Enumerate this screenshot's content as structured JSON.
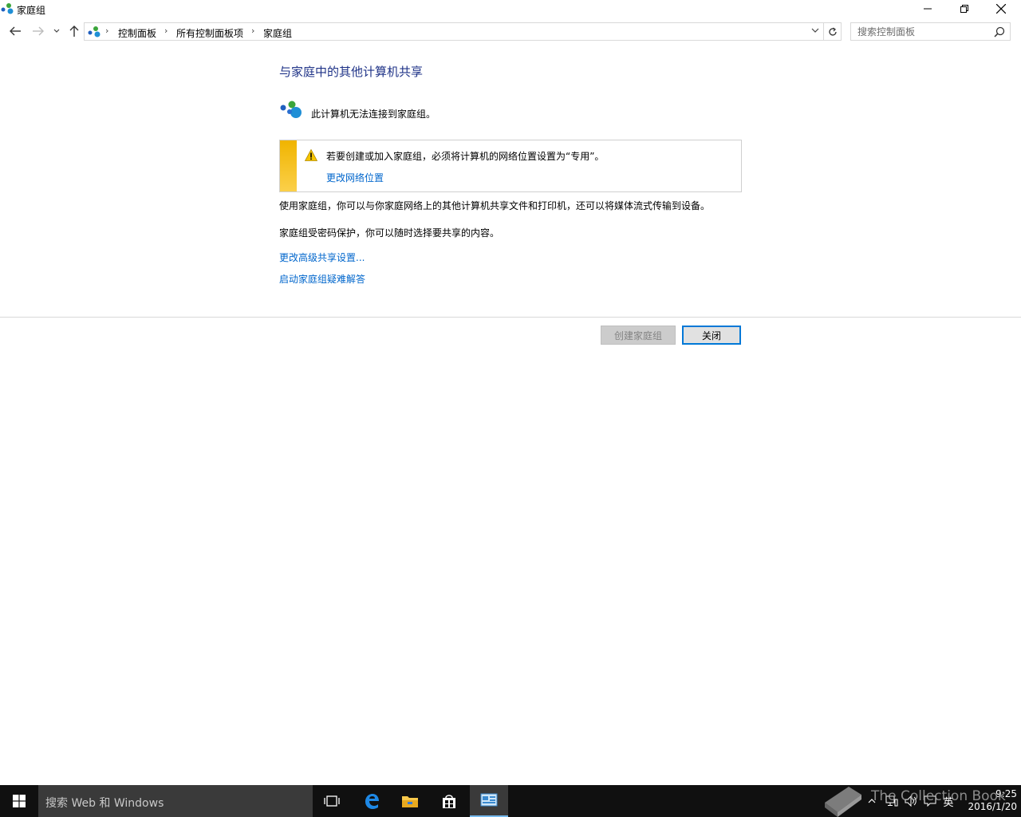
{
  "window": {
    "title": "家庭组",
    "minimize_icon": "minimize-icon",
    "restore_icon": "restore-icon",
    "close_icon": "close-icon"
  },
  "nav": {
    "breadcrumb": [
      "控制面板",
      "所有控制面板项",
      "家庭组"
    ],
    "search_placeholder": "搜索控制面板"
  },
  "main": {
    "title": "与家庭中的其他计算机共享",
    "status": "此计算机无法连接到家庭组。",
    "warning": {
      "text": "若要创建或加入家庭组，必须将计算机的网络位置设置为“专用”。",
      "link": "更改网络位置"
    },
    "description": "使用家庭组，你可以与你家庭网络上的其他计算机共享文件和打印机，还可以将媒体流式传输到设备。",
    "password_note": "家庭组受密码保护，你可以随时选择要共享的内容。",
    "links": {
      "advanced": "更改高级共享设置...",
      "troubleshoot": "启动家庭组疑难解答"
    },
    "buttons": {
      "create": "创建家庭组",
      "close": "关闭"
    }
  },
  "taskbar": {
    "search_text": "搜索 Web 和 Windows",
    "ime": "英",
    "time": "9:25",
    "date": "2016/1/20",
    "watermark": "The Collection Book",
    "accent": "#76b9ed"
  },
  "colors": {
    "title_blue": "#1e3287",
    "link_blue": "#0066cc",
    "warning_yellow": "#f0b400",
    "focus_blue": "#0078d7"
  }
}
